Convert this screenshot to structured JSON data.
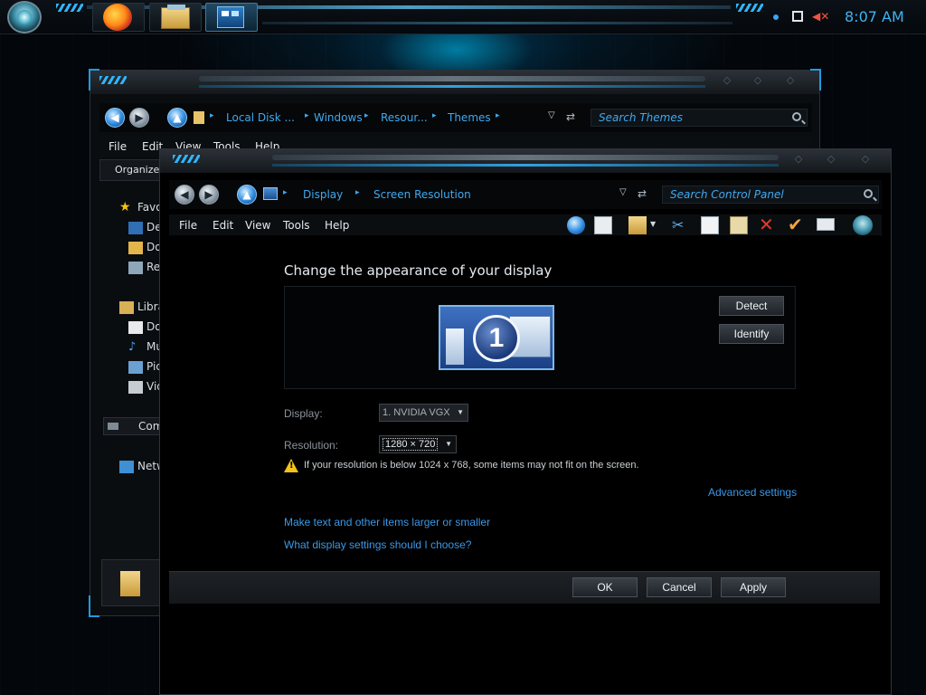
{
  "taskbar": {
    "clock": "8:07 AM",
    "pinned": [
      "firefox-icon",
      "file-explorer-icon",
      "control-panel-icon"
    ]
  },
  "back_window": {
    "breadcrumbs": [
      "Local Disk ...",
      "Windows",
      "Resour...",
      "Themes"
    ],
    "search_placeholder": "Search Themes",
    "menu": [
      "File",
      "Edit",
      "View",
      "Tools",
      "Help"
    ],
    "toolbar_button": "Organize",
    "sidebar": {
      "favorites": "Favor",
      "items_fav": [
        "Des",
        "Dov",
        "Rec"
      ],
      "libraries": "Libra",
      "items_lib": [
        "Doc",
        "Mu",
        "Pic",
        "Vid"
      ],
      "computer": "Comp",
      "network": "Netw"
    }
  },
  "front_window": {
    "breadcrumbs": [
      "Display",
      "Screen Resolution"
    ],
    "search_placeholder": "Search Control Panel",
    "menu": [
      "File",
      "Edit",
      "View",
      "Tools",
      "Help"
    ],
    "page_title": "Change the appearance of your display",
    "monitor_number": "1",
    "detect_label": "Detect",
    "identify_label": "Identify",
    "display_label": "Display:",
    "display_value": "1. NVIDIA VGX",
    "resolution_label": "Resolution:",
    "resolution_value": "1280 × 720",
    "warning": "If your resolution is below 1024 x 768, some items may not fit on the screen.",
    "advanced_settings": "Advanced settings",
    "link_text_larger": "Make text and other items larger or smaller",
    "link_which_settings": "What display settings should I choose?",
    "ok_label": "OK",
    "cancel_label": "Cancel",
    "apply_label": "Apply"
  },
  "colors": {
    "accent": "#3fa9ef",
    "link": "#3a98e8",
    "warning": "#f2c318"
  }
}
